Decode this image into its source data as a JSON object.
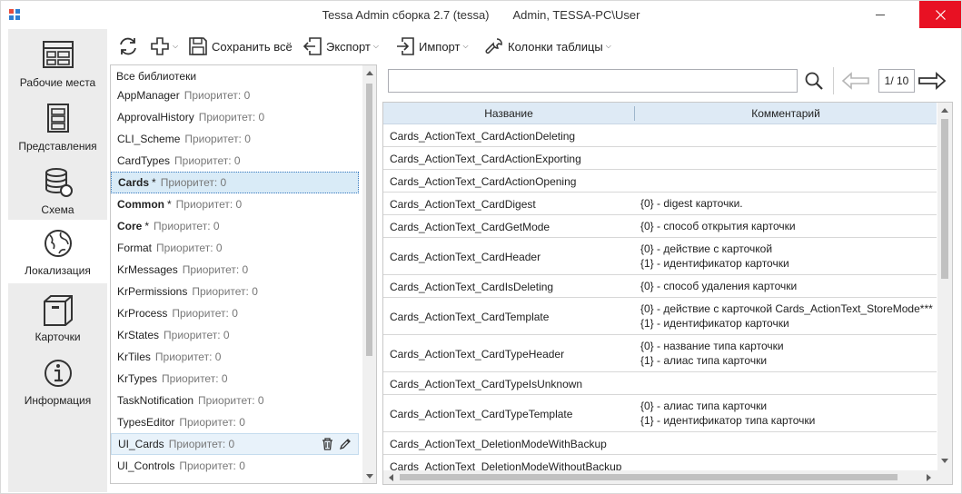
{
  "window": {
    "title": "Tessa Admin сборка 2.7 (tessa)",
    "user": "Admin, TESSA-PC\\User"
  },
  "nav": {
    "items": [
      {
        "label": "Рабочие места",
        "icon": "workplaces-icon"
      },
      {
        "label": "Представления",
        "icon": "views-icon"
      },
      {
        "label": "Схема",
        "icon": "database-icon"
      },
      {
        "label": "Локализация",
        "icon": "globe-icon"
      },
      {
        "label": "Карточки",
        "icon": "box-icon"
      },
      {
        "label": "Информация",
        "icon": "info-icon"
      }
    ],
    "active": "Локализация"
  },
  "toolbar": {
    "save_all": "Сохранить всё",
    "export": "Экспорт",
    "import": "Импорт",
    "columns": "Колонки таблицы"
  },
  "libraries": {
    "header": "Все библиотеки",
    "items": [
      {
        "name": "AppManager",
        "modified": "",
        "priority": "Приоритет: 0"
      },
      {
        "name": "ApprovalHistory",
        "modified": "",
        "priority": "Приоритет: 0"
      },
      {
        "name": "CLI_Scheme",
        "modified": "",
        "priority": "Приоритет: 0"
      },
      {
        "name": "CardTypes",
        "modified": "",
        "priority": "Приоритет: 0"
      },
      {
        "name": "Cards",
        "modified": "*",
        "priority": "Приоритет: 0"
      },
      {
        "name": "Common",
        "modified": "*",
        "priority": "Приоритет: 0"
      },
      {
        "name": "Core",
        "modified": "*",
        "priority": "Приоритет: 0"
      },
      {
        "name": "Format",
        "modified": "",
        "priority": "Приоритет: 0"
      },
      {
        "name": "KrMessages",
        "modified": "",
        "priority": "Приоритет: 0"
      },
      {
        "name": "KrPermissions",
        "modified": "",
        "priority": "Приоритет: 0"
      },
      {
        "name": "KrProcess",
        "modified": "",
        "priority": "Приоритет: 0"
      },
      {
        "name": "KrStates",
        "modified": "",
        "priority": "Приоритет: 0"
      },
      {
        "name": "KrTiles",
        "modified": "",
        "priority": "Приоритет: 0"
      },
      {
        "name": "KrTypes",
        "modified": "",
        "priority": "Приоритет: 0"
      },
      {
        "name": "TaskNotification",
        "modified": "",
        "priority": "Приоритет: 0"
      },
      {
        "name": "TypesEditor",
        "modified": "",
        "priority": "Приоритет: 0"
      },
      {
        "name": "UI_Cards",
        "modified": "",
        "priority": "Приоритет: 0"
      },
      {
        "name": "UI_Controls",
        "modified": "",
        "priority": "Приоритет: 0"
      }
    ]
  },
  "search": {
    "value": "",
    "page": "1/ 10"
  },
  "grid": {
    "columns": [
      "Название",
      "Комментарий"
    ],
    "rows": [
      {
        "name": "Cards_ActionText_CardActionDeleting",
        "comment": [
          "",
          ""
        ]
      },
      {
        "name": "Cards_ActionText_CardActionExporting",
        "comment": [
          "",
          ""
        ]
      },
      {
        "name": "Cards_ActionText_CardActionOpening",
        "comment": [
          "",
          ""
        ]
      },
      {
        "name": "Cards_ActionText_CardDigest",
        "comment": [
          "{0} - digest карточки.",
          ""
        ]
      },
      {
        "name": "Cards_ActionText_CardGetMode",
        "comment": [
          "{0} - способ открытия карточки",
          ""
        ]
      },
      {
        "name": "Cards_ActionText_CardHeader",
        "comment": [
          "{0} - действие с карточкой",
          "{1} - идентификатор карточки"
        ]
      },
      {
        "name": "Cards_ActionText_CardIsDeleting",
        "comment": [
          "{0} - способ удаления карточки",
          ""
        ]
      },
      {
        "name": "Cards_ActionText_CardTemplate",
        "comment": [
          "{0} - действие с карточкой Cards_ActionText_StoreMode***",
          "{1} - идентификатор карточки"
        ]
      },
      {
        "name": "Cards_ActionText_CardTypeHeader",
        "comment": [
          "{0} - название типа карточки",
          "{1} - алиас типа карточки"
        ]
      },
      {
        "name": "Cards_ActionText_CardTypeIsUnknown",
        "comment": [
          "",
          ""
        ]
      },
      {
        "name": "Cards_ActionText_CardTypeTemplate",
        "comment": [
          "{0} - алиас типа карточки",
          "{1} - идентификатор типа карточки"
        ]
      },
      {
        "name": "Cards_ActionText_DeletionModeWithBackup",
        "comment": [
          "",
          ""
        ]
      },
      {
        "name": "Cards_ActionText_DeletionModeWithoutBackup",
        "comment": [
          "",
          ""
        ]
      }
    ]
  },
  "colors": {
    "accent": "#3a7bbf",
    "close": "#e81123",
    "header": "#deeaf5",
    "selected": "#d9ebf7"
  }
}
